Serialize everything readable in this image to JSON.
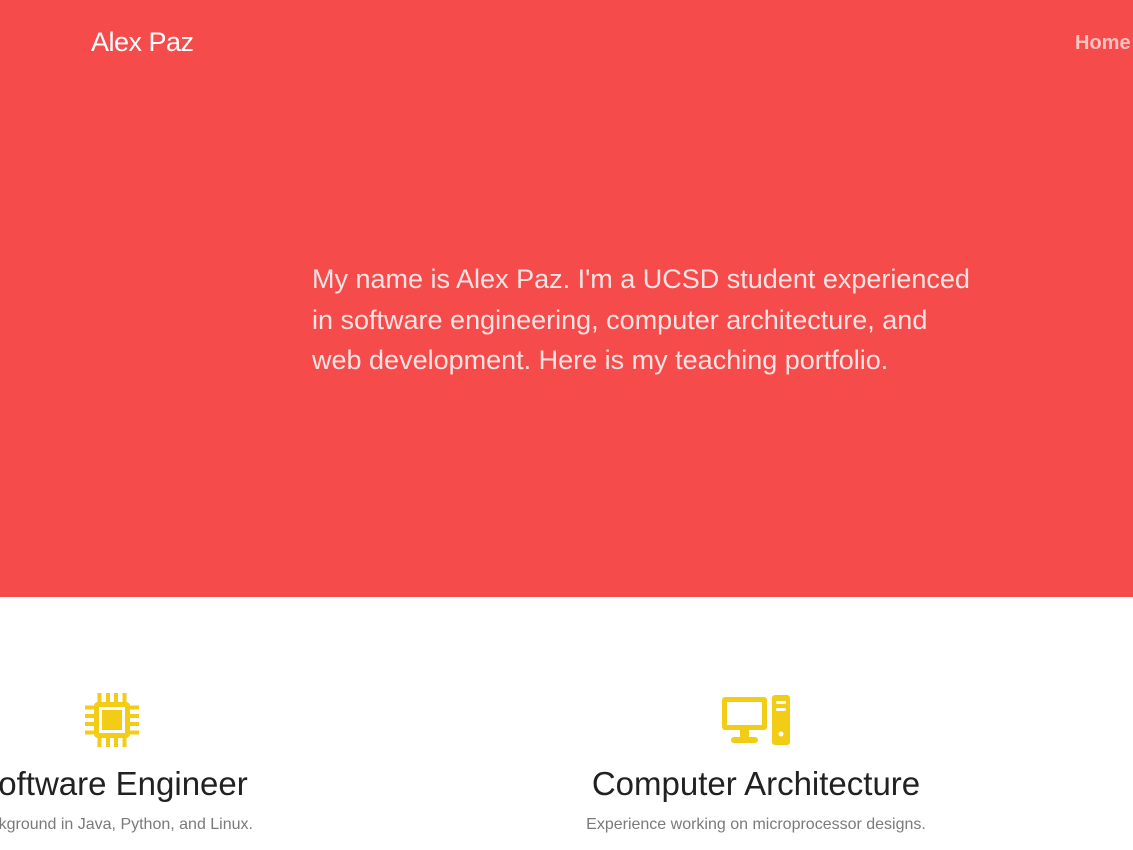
{
  "header": {
    "brand": "Alex Paz",
    "nav": [
      {
        "label": "Home"
      }
    ]
  },
  "hero": {
    "intro": "My name is Alex Paz. I'm a UCSD student experienced in software engineering, computer architecture, and web development. Here is my teaching portfolio."
  },
  "features": [
    {
      "icon": "microchip-icon",
      "title": "Software Engineer",
      "description": "Background in Java, Python, and Linux."
    },
    {
      "icon": "desktop-computer-icon",
      "title": "Computer Architecture",
      "description": "Experience working on microprocessor designs."
    }
  ],
  "colors": {
    "hero_background": "#f54b4b",
    "icon_accent": "#f2cc15",
    "heading_text": "#212121",
    "muted_text": "#7a7a7a"
  }
}
